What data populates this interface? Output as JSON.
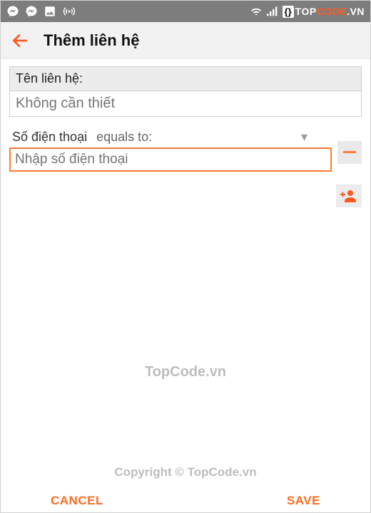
{
  "appbar": {
    "title": "Thêm liên hệ"
  },
  "form": {
    "name_label": "Tên liên hệ:",
    "name_placeholder": "Không cần thiết",
    "phone_label": "Số điện thoại",
    "equals_label": "equals to:",
    "phone_placeholder": "Nhập số điện thoại"
  },
  "watermark": {
    "center": "TopCode.vn",
    "copyright": "Copyright © TopCode.vn"
  },
  "footer": {
    "cancel": "CANCEL",
    "save": "SAVE"
  },
  "brand": {
    "top": "TOP",
    "code": "CODE",
    "tld": ".VN"
  }
}
